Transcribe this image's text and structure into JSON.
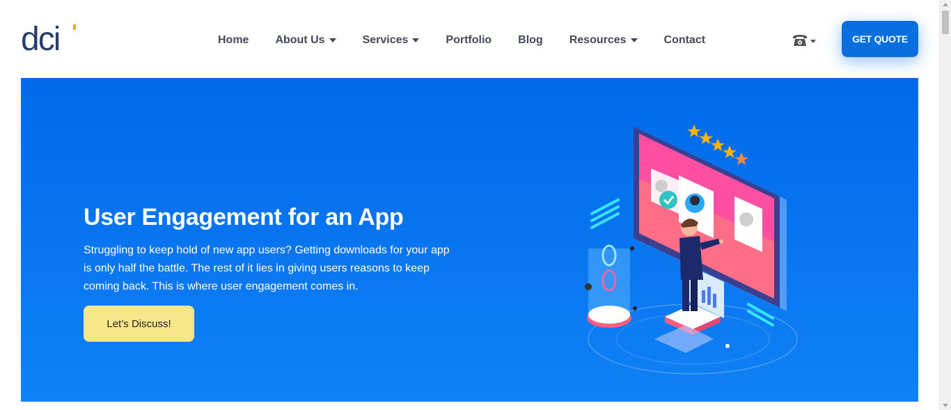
{
  "brand": {
    "logo_text": "dci",
    "accent": "#f5a623",
    "primary": "#2a3e6e"
  },
  "nav": {
    "items": [
      {
        "label": "Home",
        "dropdown": false
      },
      {
        "label": "About Us",
        "dropdown": true
      },
      {
        "label": "Services",
        "dropdown": true
      },
      {
        "label": "Portfolio",
        "dropdown": false
      },
      {
        "label": "Blog",
        "dropdown": false
      },
      {
        "label": "Resources",
        "dropdown": true
      },
      {
        "label": "Contact",
        "dropdown": false
      }
    ],
    "phone_icon": "☎",
    "quote_button": "GET QUOTE"
  },
  "hero": {
    "title": "User Engagement for an App",
    "description": "Struggling to keep hold of new app users? Getting downloads for your app is only half the battle. The rest of it lies in giving users reasons to keep coming back. This is where user engagement comes in.",
    "cta_label": "Let’s Discuss!",
    "cta_color": "#f8e68a",
    "background": "#0069ea",
    "illustration": "person-with-app-screen-illustration"
  },
  "colors": {
    "quote_button": "#0a6fde",
    "nav_text": "#444a55"
  }
}
